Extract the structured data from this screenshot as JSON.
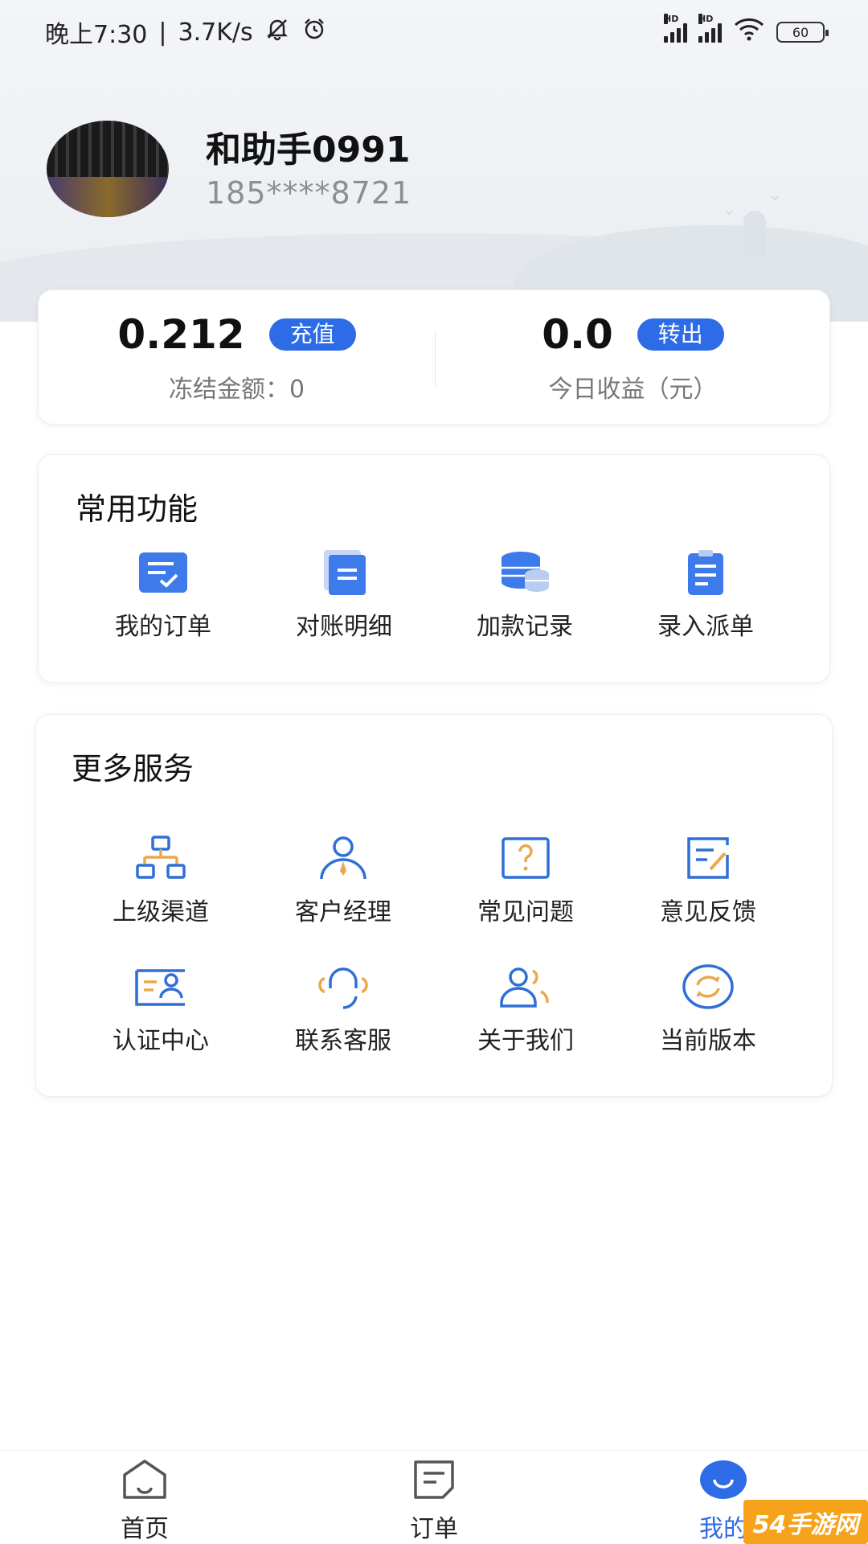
{
  "status_bar": {
    "time": "晚上7:30",
    "network_speed": "3.7K/s",
    "battery": "60",
    "icons": [
      "bell-off-icon",
      "alarm-icon",
      "signal-hd-icon",
      "signal-hd-icon",
      "wifi-icon",
      "battery-icon"
    ]
  },
  "profile": {
    "name": "和助手0991",
    "phone": "185****8721"
  },
  "balance": {
    "balance_value": "0.212",
    "recharge_label": "充值",
    "frozen_label": "冻结金额：0",
    "earnings_value": "0.0",
    "transfer_label": "转出",
    "earnings_label": "今日收益（元）"
  },
  "common": {
    "title": "常用功能",
    "items": [
      {
        "label": "我的订单",
        "icon": "order-check-icon"
      },
      {
        "label": "对账明细",
        "icon": "statement-icon"
      },
      {
        "label": "加款记录",
        "icon": "coins-icon"
      },
      {
        "label": "录入派单",
        "icon": "clipboard-icon"
      }
    ]
  },
  "more": {
    "title": "更多服务",
    "items": [
      {
        "label": "上级渠道",
        "icon": "hierarchy-icon"
      },
      {
        "label": "客户经理",
        "icon": "manager-icon"
      },
      {
        "label": "常见问题",
        "icon": "question-icon"
      },
      {
        "label": "意见反馈",
        "icon": "feedback-icon"
      },
      {
        "label": "认证中心",
        "icon": "id-card-icon"
      },
      {
        "label": "联系客服",
        "icon": "headset-icon"
      },
      {
        "label": "关于我们",
        "icon": "users-icon"
      },
      {
        "label": "当前版本",
        "icon": "refresh-icon"
      }
    ]
  },
  "nav": {
    "items": [
      {
        "label": "首页",
        "icon": "home-icon"
      },
      {
        "label": "订单",
        "icon": "orders-icon"
      },
      {
        "label": "我的",
        "icon": "profile-icon"
      }
    ],
    "active_index": 2
  },
  "watermark": {
    "text": "54手游网"
  },
  "colors": {
    "accent": "#2e6be6",
    "icon_orange": "#e9a94b",
    "icon_blue": "#2f6fd6"
  }
}
